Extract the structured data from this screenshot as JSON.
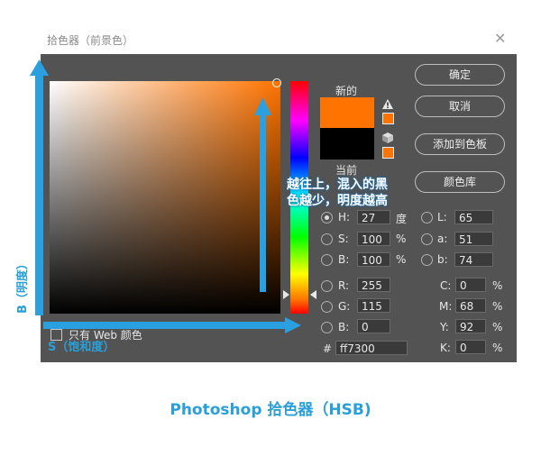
{
  "dialog": {
    "title": "拾色器（前景色）"
  },
  "labels": {
    "new": "新的",
    "current": "当前",
    "web_only": "只有 Web 颜色"
  },
  "buttons": {
    "ok": "确定",
    "cancel": "取消",
    "add_swatch": "添加到色板",
    "color_library": "颜色库"
  },
  "hsb": [
    {
      "label": "H:",
      "value": "27",
      "unit": "度"
    },
    {
      "label": "S:",
      "value": "100",
      "unit": "%"
    },
    {
      "label": "B:",
      "value": "100",
      "unit": "%"
    }
  ],
  "rgb": [
    {
      "label": "R:",
      "value": "255"
    },
    {
      "label": "G:",
      "value": "115"
    },
    {
      "label": "B:",
      "value": "0"
    }
  ],
  "lab": [
    {
      "label": "L:",
      "value": "65"
    },
    {
      "label": "a:",
      "value": "51"
    },
    {
      "label": "b:",
      "value": "74"
    }
  ],
  "cmyk": [
    {
      "label": "C:",
      "value": "0",
      "unit": "%"
    },
    {
      "label": "M:",
      "value": "68",
      "unit": "%"
    },
    {
      "label": "Y:",
      "value": "92",
      "unit": "%"
    },
    {
      "label": "K:",
      "value": "0",
      "unit": "%"
    }
  ],
  "hex": {
    "label": "#",
    "value": "ff7300"
  },
  "annotations": {
    "vertical_note": "越往上，混入的黑色越少，明度越高",
    "b_axis": "B（明度）",
    "s_axis": "S（饱和度）"
  },
  "caption": "Photoshop 拾色器（HSB)",
  "colors": {
    "selected": "#ff7300",
    "current": "#000000",
    "annotation_blue": "#2aa0e0"
  },
  "icons": {
    "warning": "warning-triangle-icon",
    "web_safe": "cube-icon",
    "close": "close-icon"
  }
}
